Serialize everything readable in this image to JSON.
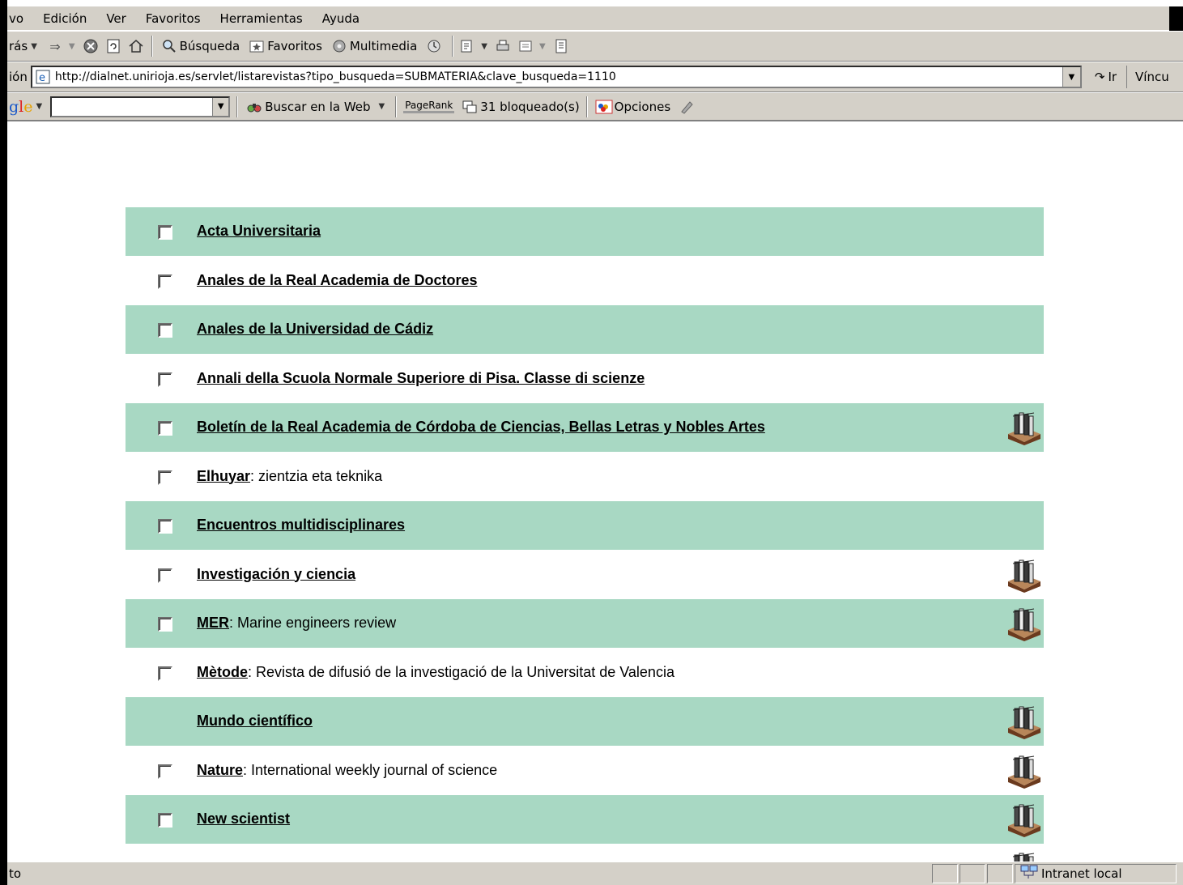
{
  "menu": [
    "vo",
    "Edición",
    "Ver",
    "Favoritos",
    "Herramientas",
    "Ayuda"
  ],
  "toolbar": {
    "back_label": "rás",
    "search_label": "Búsqueda",
    "favorites_label": "Favoritos",
    "media_label": "Multimedia"
  },
  "address": {
    "label": "ión",
    "url": "http://dialnet.unirioja.es/servlet/listarevistas?tipo_busqueda=SUBMATERIA&clave_busqueda=1110",
    "go_label": "Ir",
    "links_label": "Víncu"
  },
  "googlebar": {
    "logo_part1": "g",
    "logo_part2": "l",
    "logo_part3": "e",
    "search_web_label": "Buscar en la Web",
    "pagerank_label": "PageRank",
    "blocked_label": "31 bloqueado(s)",
    "options_label": "Opciones"
  },
  "journals": [
    {
      "title": "Acta Universitaria",
      "subtitle": "",
      "has_checkbox": true,
      "has_book": false,
      "shaded": true
    },
    {
      "title": "Anales de la Real Academia de Doctores",
      "subtitle": "",
      "has_checkbox": true,
      "has_book": false,
      "shaded": false
    },
    {
      "title": "Anales de la Universidad de Cádiz",
      "subtitle": "",
      "has_checkbox": true,
      "has_book": false,
      "shaded": true
    },
    {
      "title": "Annali della Scuola Normale Superiore di Pisa. Classe di scienze",
      "subtitle": "",
      "has_checkbox": true,
      "has_book": false,
      "shaded": false
    },
    {
      "title": "Boletín de la Real Academia de Córdoba de Ciencias, Bellas Letras y Nobles Artes",
      "subtitle": "",
      "has_checkbox": true,
      "has_book": true,
      "shaded": true
    },
    {
      "title": "Elhuyar",
      "subtitle": ": zientzia eta teknika",
      "has_checkbox": true,
      "has_book": false,
      "shaded": false
    },
    {
      "title": "Encuentros multidisciplinares",
      "subtitle": "",
      "has_checkbox": true,
      "has_book": false,
      "shaded": true
    },
    {
      "title": "Investigación y ciencia",
      "subtitle": "",
      "has_checkbox": true,
      "has_book": true,
      "shaded": false
    },
    {
      "title": "MER",
      "subtitle": ": Marine engineers review",
      "has_checkbox": true,
      "has_book": true,
      "shaded": true
    },
    {
      "title": "Mètode",
      "subtitle": ": Revista de difusió de la investigació de la Universitat de Valencia",
      "has_checkbox": true,
      "has_book": false,
      "shaded": false
    },
    {
      "title": "Mundo científico",
      "subtitle": "",
      "has_checkbox": false,
      "has_book": true,
      "shaded": true
    },
    {
      "title": "Nature",
      "subtitle": ": International weekly journal of science",
      "has_checkbox": true,
      "has_book": true,
      "shaded": false
    },
    {
      "title": "New scientist",
      "subtitle": "",
      "has_checkbox": true,
      "has_book": true,
      "shaded": true
    }
  ],
  "status": {
    "text": "to",
    "zone_label": "Intranet local"
  },
  "colors": {
    "row_shade": "#a8d8c3",
    "chrome": "#d4d0c8"
  }
}
